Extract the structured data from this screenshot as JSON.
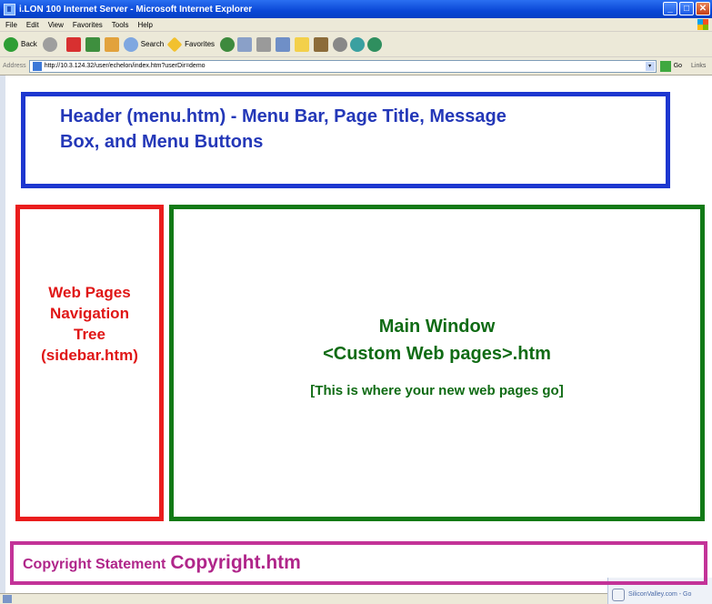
{
  "window": {
    "title": "i.LON 100 Internet Server - Microsoft Internet Explorer"
  },
  "menu": {
    "items": [
      "File",
      "Edit",
      "View",
      "Favorites",
      "Tools",
      "Help"
    ]
  },
  "toolbar": {
    "back_label": "Back",
    "search_label": "Search",
    "favorites_label": "Favorites"
  },
  "address": {
    "label": "Address",
    "url": "http://10.3.124.32/user/echelon/index.htm?userDir=demo",
    "go_label": "Go",
    "links_label": "Links"
  },
  "layout_boxes": {
    "header": {
      "line1": "Header (menu.htm) - Menu Bar, Page Title, Message",
      "line2": "Box, and Menu Buttons",
      "color": "#1d37d0"
    },
    "sidebar": {
      "lines": [
        "Web Pages",
        "Navigation",
        "Tree",
        "(sidebar.htm)"
      ],
      "color": "#ea1d1d"
    },
    "main": {
      "title_line1": "Main Window",
      "title_line2": "<Custom Web pages>.htm",
      "subtitle": "[This is where your new web pages go]",
      "color": "#127a16"
    },
    "copyright": {
      "label": "Copyright Statement",
      "file": "Copyright.htm",
      "color": "#c33398"
    }
  },
  "status": {
    "thumbnail_text": "SiliconValley.com - Go"
  }
}
